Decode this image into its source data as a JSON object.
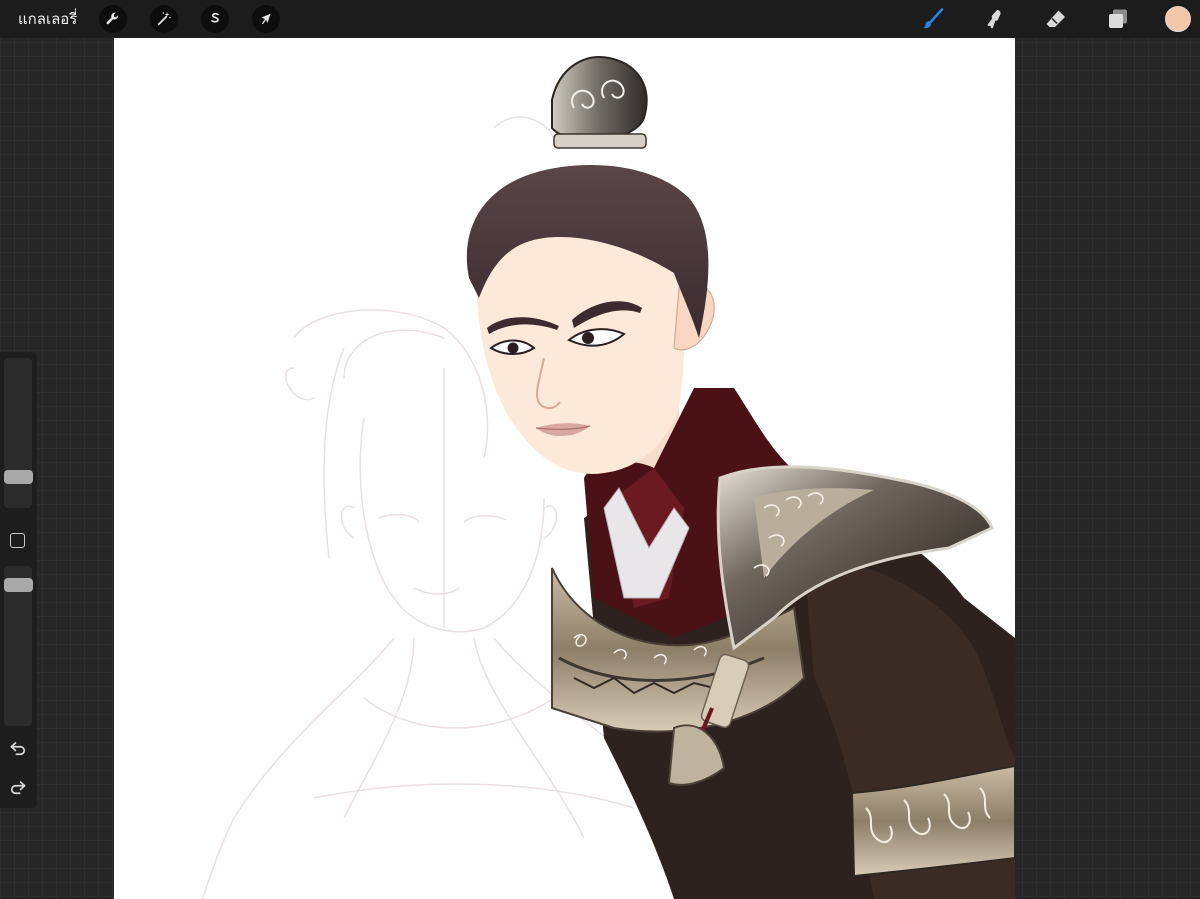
{
  "topbar": {
    "gallery_label": "แกลเลอรี่",
    "left_tools": [
      {
        "name": "actions",
        "icon": "wrench-icon"
      },
      {
        "name": "adjustments",
        "icon": "magic-wand-icon"
      },
      {
        "name": "selection",
        "icon": "selection-s-icon"
      },
      {
        "name": "transform",
        "icon": "arrow-cursor-icon"
      }
    ],
    "right_tools": [
      {
        "name": "brush",
        "icon": "brush-icon",
        "active": true
      },
      {
        "name": "smudge",
        "icon": "smudge-icon",
        "active": false
      },
      {
        "name": "eraser",
        "icon": "eraser-icon",
        "active": false
      },
      {
        "name": "layers",
        "icon": "layers-icon",
        "active": false
      }
    ],
    "current_color": "#f4c7a9",
    "active_tool_color": "#2f7fe6"
  },
  "sidebar": {
    "brush_size_level": 0.18,
    "opacity_level": 0.92,
    "modify_icon": "square-icon",
    "undo_icon": "undo-icon",
    "redo_icon": "redo-icon"
  },
  "colors": {
    "background": "#262626",
    "topbar": "#1c1c1c",
    "canvas": "#ffffff",
    "hair": "#4a383c",
    "skin": "#fde9da",
    "robe_dark": "#2d221d",
    "collar_red": "#4a1216",
    "armor_metal": "#8a7f72",
    "sketch_lines": "#e8d9de"
  }
}
